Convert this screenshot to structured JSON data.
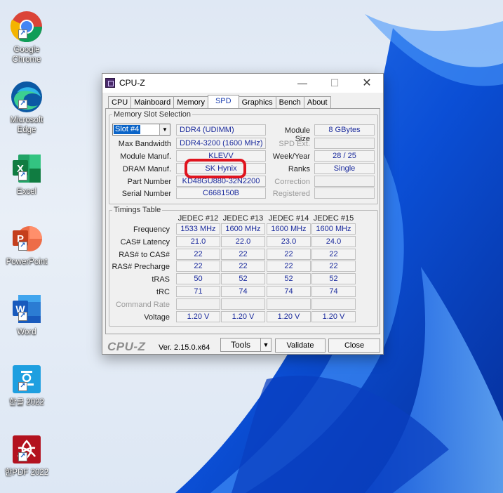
{
  "desktop": {
    "icons": [
      {
        "label": "Google\nChrome",
        "icon": "chrome-icon"
      },
      {
        "label": "Microsoft\nEdge",
        "icon": "edge-icon"
      },
      {
        "label": "Excel",
        "icon": "excel-icon"
      },
      {
        "label": "PowerPoint",
        "icon": "powerpoint-icon"
      },
      {
        "label": "Word",
        "icon": "word-icon"
      },
      {
        "label": "한글 2022",
        "icon": "hangul-icon"
      },
      {
        "label": "한PDF 2022",
        "icon": "hanpdf-icon"
      }
    ]
  },
  "window": {
    "title": "CPU-Z",
    "controls": {
      "minimize": "—",
      "maximize": "☐",
      "close": "✕"
    },
    "tabs": [
      "CPU",
      "Mainboard",
      "Memory",
      "SPD",
      "Graphics",
      "Bench",
      "About"
    ],
    "active_tab": "SPD",
    "slot_group": {
      "legend": "Memory Slot Selection",
      "slot": "Slot #4",
      "type": "DDR4 (UDIMM)",
      "module_size_label": "Module Size",
      "module_size": "8 GBytes",
      "max_bandwidth_label": "Max Bandwidth",
      "max_bandwidth": "DDR4-3200 (1600 MHz)",
      "spd_ext_label": "SPD Ext.",
      "module_manuf_label": "Module Manuf.",
      "module_manuf": "KLEVV",
      "week_year_label": "Week/Year",
      "week_year": "28 / 25",
      "dram_manuf_label": "DRAM Manuf.",
      "dram_manuf": "SK Hynix",
      "ranks_label": "Ranks",
      "ranks": "Single",
      "part_number_label": "Part Number",
      "part_number": "KD48GU880-32N2200",
      "correction_label": "Correction",
      "serial_number_label": "Serial Number",
      "serial_number": "C668150B",
      "registered_label": "Registered"
    },
    "timings": {
      "legend": "Timings Table",
      "columns": [
        "JEDEC #12",
        "JEDEC #13",
        "JEDEC #14",
        "JEDEC #15"
      ],
      "rows": [
        {
          "label": "Frequency",
          "values": [
            "1533 MHz",
            "1600 MHz",
            "1600 MHz",
            "1600 MHz"
          ]
        },
        {
          "label": "CAS# Latency",
          "values": [
            "21.0",
            "22.0",
            "23.0",
            "24.0"
          ]
        },
        {
          "label": "RAS# to CAS#",
          "values": [
            "22",
            "22",
            "22",
            "22"
          ]
        },
        {
          "label": "RAS# Precharge",
          "values": [
            "22",
            "22",
            "22",
            "22"
          ]
        },
        {
          "label": "tRAS",
          "values": [
            "50",
            "52",
            "52",
            "52"
          ]
        },
        {
          "label": "tRC",
          "values": [
            "71",
            "74",
            "74",
            "74"
          ]
        },
        {
          "label": "Command Rate",
          "values": [
            "",
            "",
            "",
            ""
          ]
        },
        {
          "label": "Voltage",
          "values": [
            "1.20 V",
            "1.20 V",
            "1.20 V",
            "1.20 V"
          ]
        }
      ]
    },
    "footer": {
      "brand": "CPU-Z",
      "version": "Ver. 2.15.0.x64",
      "tools": "Tools",
      "validate": "Validate",
      "close": "Close"
    },
    "colors": {
      "value_text": "#1a2a9c",
      "highlight": "#e0141e",
      "active_tab_text": "#1b3fb0"
    }
  }
}
